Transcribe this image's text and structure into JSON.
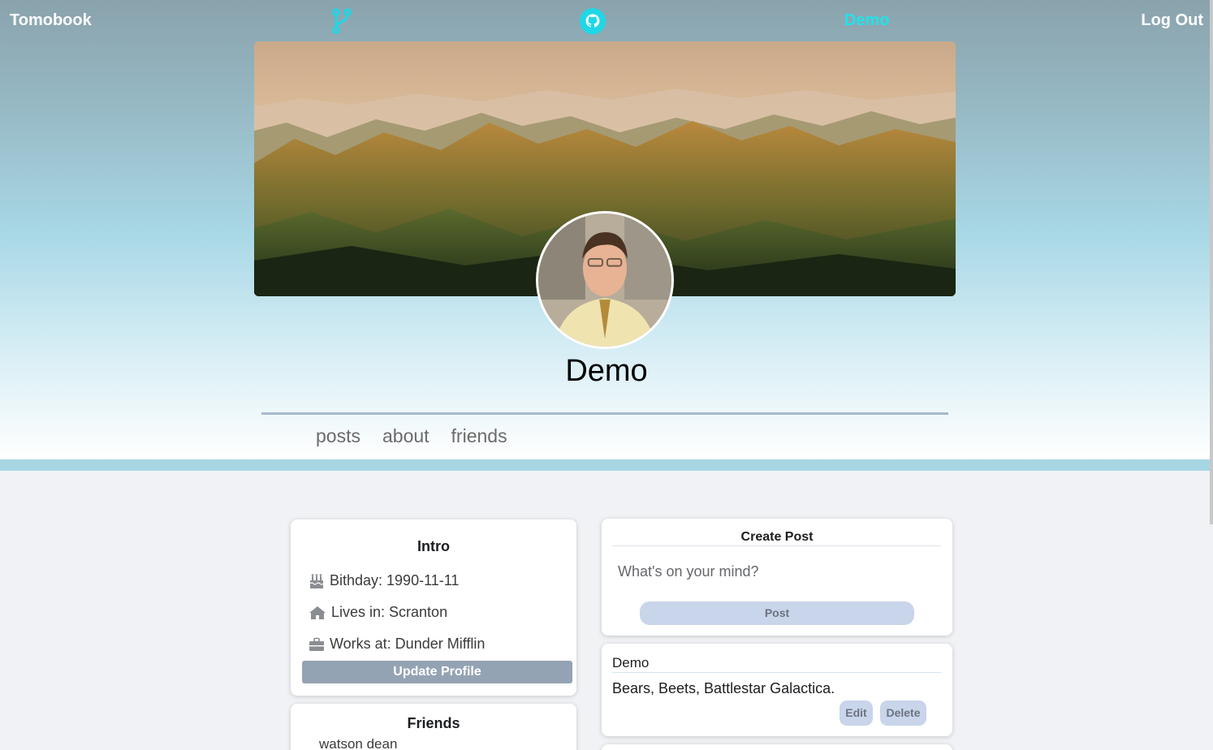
{
  "app": {
    "brand": "Tomobook"
  },
  "nav": {
    "user_label": "Demo",
    "logout_label": "Log Out",
    "branch_icon": "git-branch-icon",
    "github_icon": "github-icon"
  },
  "profile": {
    "name": "Demo",
    "cover_image": "mountain-landscape",
    "avatar_image": "user-avatar-photo"
  },
  "tabs": [
    {
      "label": "posts"
    },
    {
      "label": "about"
    },
    {
      "label": "friends"
    }
  ],
  "intro": {
    "title": "Intro",
    "birthday": "Bithday: 1990-11-11",
    "lives_in": "Lives in: Scranton",
    "works_at": "Works at: Dunder Mifflin",
    "update_button": "Update Profile"
  },
  "friends": {
    "title": "Friends",
    "items": [
      "watson dean"
    ]
  },
  "create_post": {
    "title": "Create Post",
    "placeholder": "What's on your mind?",
    "post_button": "Post"
  },
  "posts": [
    {
      "author": "Demo",
      "body": "Bears, Beets, Battlestar Galactica.",
      "edit_label": "Edit",
      "delete_label": "Delete"
    }
  ],
  "colors": {
    "accent": "#1fe3ec",
    "button_primary": "#94a3b4",
    "button_soft": "#c8d5ea",
    "page_bg": "#f0f2f5"
  }
}
